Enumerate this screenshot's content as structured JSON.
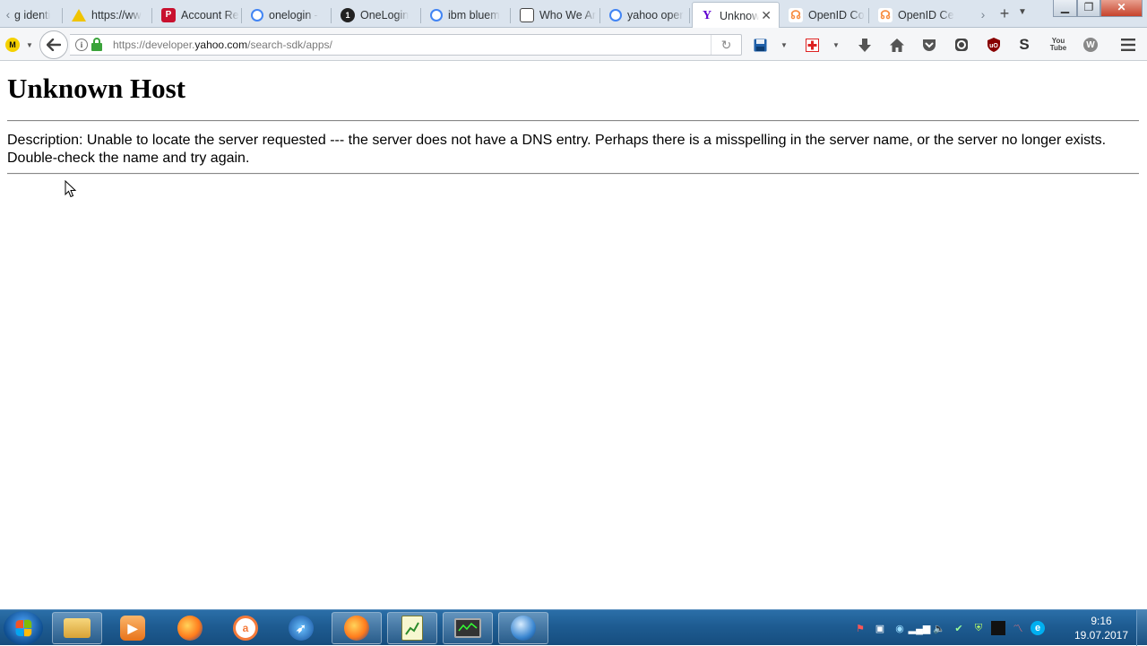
{
  "browser": {
    "tabs": [
      {
        "title": "g identi",
        "icon": "google-icon"
      },
      {
        "title": "https://ww",
        "icon": "warning-icon"
      },
      {
        "title": "Account Re",
        "icon": "p-logo-icon"
      },
      {
        "title": "onelogin -",
        "icon": "google-icon"
      },
      {
        "title": "OneLogin",
        "icon": "onelogin-icon"
      },
      {
        "title": "ibm bluem",
        "icon": "google-icon"
      },
      {
        "title": "Who We Ar",
        "icon": "document-icon"
      },
      {
        "title": "yahoo oper",
        "icon": "google-icon"
      },
      {
        "title": "Unknow",
        "icon": "yahoo-icon",
        "active": true
      },
      {
        "title": "OpenID Co",
        "icon": "openid-icon"
      },
      {
        "title": "OpenID Ce",
        "icon": "openid-icon"
      }
    ],
    "url": {
      "prefix": "https://developer.",
      "domain": "yahoo.com",
      "path": "/search-sdk/apps/"
    },
    "addon_badge": "M",
    "onelogin_glyph": "1",
    "yahoo_glyph": "Y",
    "p_glyph": "P",
    "toolbar_icons": [
      "save-icon",
      "first-aid-icon",
      "download-icon",
      "home-icon",
      "pocket-icon",
      "sync-icon",
      "ublock-icon",
      "s-addon-icon",
      "youtube-icon",
      "w-addon-icon",
      "menu-icon"
    ],
    "youtube_glyph": "You Tube",
    "s_addon_glyph": "S",
    "w_addon_glyph": "W",
    "ublock_glyph": "uO"
  },
  "page": {
    "heading": "Unknown Host",
    "description": "Description: Unable to locate the server requested --- the server does not have a DNS entry. Perhaps there is a misspelling in the server name, or the server no longer exists. Double-check the name and try again."
  },
  "taskbar": {
    "apps": [
      "file-explorer-icon",
      "media-player-icon",
      "firefox-icon",
      "antivirus-icon",
      "safari-like-icon",
      "firefox-active-icon",
      "notepad-chart-icon",
      "system-monitor-icon",
      "network-globe-icon"
    ],
    "clock": {
      "time": "9:16",
      "date": "19.07.2017"
    }
  },
  "colors": {
    "tabstrip_bg": "#dbe4ee",
    "taskbar": "#1e5c92",
    "lock_green": "#3aa33a"
  }
}
